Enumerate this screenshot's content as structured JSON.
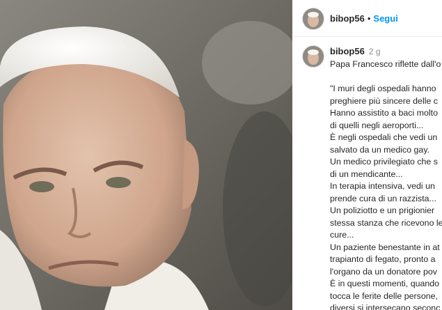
{
  "header": {
    "username": "bibop56",
    "separator": "•",
    "follow_label": "Segui"
  },
  "post": {
    "username": "bibop56",
    "time": "2 g",
    "first_line": "Papa Francesco riflette dall'o",
    "lines": [
      "",
      "\"I muri degli ospedali hanno",
      "preghiere più sincere delle c",
      "Hanno assistito a baci molto",
      "di quelli negli aeroporti...",
      "È negli ospedali che vedi un",
      "salvato da un medico gay.",
      "Un medico privilegiato che s",
      "di un mendicante...",
      "In terapia intensiva, vedi un",
      "prende cura di un razzista...",
      "Un poliziotto e un prigionier",
      "stessa stanza che ricevono le",
      "cure...",
      "Un paziente benestante in at",
      "trapianto di fegato, pronto a",
      "l'organo da un donatore pov",
      "È in questi momenti, quando",
      "tocca le ferite delle persone,",
      "diversi si intersecano seconc"
    ]
  },
  "photo": {
    "subject": "Pope Francis portrait",
    "colors": {
      "background": "#6d6a63",
      "zucchetto": "#f2f0ea",
      "skin": "#d9b8a4"
    }
  },
  "icons": {
    "avatar": "profile-photo",
    "photo": "portrait-photo"
  }
}
